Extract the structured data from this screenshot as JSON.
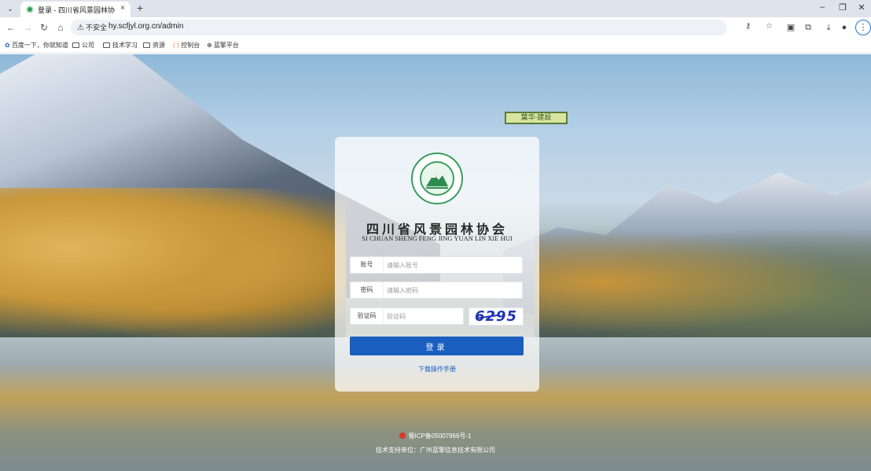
{
  "browser": {
    "tab_title": "登录 - 四川省风景园林协会会员",
    "tab_close": "×",
    "new_tab": "+",
    "insecure_label": "不安全",
    "url": "hy.scfjyl.org.cn/admin",
    "window_controls": [
      "–",
      "❐",
      "✕"
    ],
    "bookmarks": [
      "百度一下，你就知道",
      "公司",
      "技术学习",
      "资源",
      "控制台",
      "蓝擎平台"
    ]
  },
  "page": {
    "sign_text": "葉华·建設",
    "org_name_cn": "四川省风景园林协会",
    "org_name_en": "SI CHUAN SHENG FENG JING YUAN LIN XIE HUI",
    "form": {
      "account_label": "账号",
      "account_placeholder": "请输入账号",
      "password_label": "密码",
      "password_placeholder": "请输入密码",
      "captcha_label": "验证码",
      "captcha_placeholder": "验证码",
      "captcha_text": "6295",
      "submit_label": "登录"
    },
    "manual_link": "下载操作手册",
    "footer": {
      "icp": "蜀ICP备05007966号-1",
      "tech_support": "技术支持单位：广州蓝擎信息技术有限公司"
    }
  },
  "colors": {
    "primary_button": "#1a5fbf",
    "logo_green": "#3a9d5d",
    "captcha_blue": "#2034b0"
  }
}
